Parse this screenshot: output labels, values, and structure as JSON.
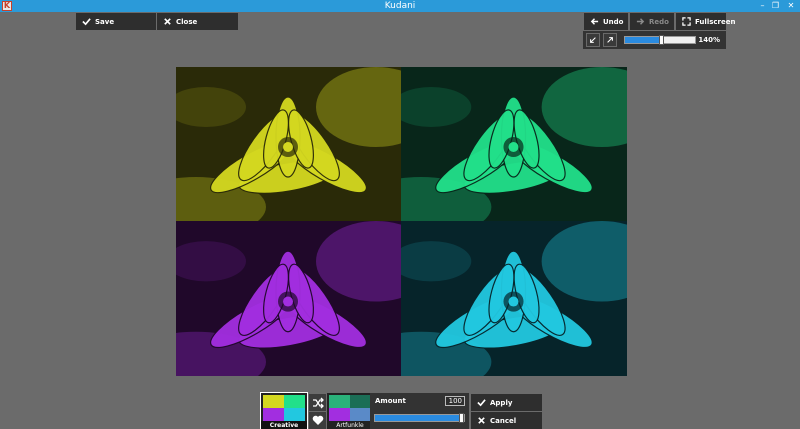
{
  "window": {
    "title": "Kudani",
    "app_icon_letter": "K",
    "minimize": "–",
    "maximize": "❐",
    "close": "✕"
  },
  "toolbar": {
    "save_label": "Save",
    "close_label": "Close",
    "undo_label": "Undo",
    "redo_label": "Redo",
    "fullscreen_label": "Fullscreen"
  },
  "zoom": {
    "value_label": "140%",
    "fraction": 0.52
  },
  "canvas": {
    "tiles": [
      {
        "name": "yellow",
        "color": "#d4d820",
        "dark": "#2a2a08"
      },
      {
        "name": "green",
        "color": "#22e08a",
        "dark": "#08261a"
      },
      {
        "name": "purple",
        "color": "#a22ee0",
        "dark": "#20082a"
      },
      {
        "name": "cyan",
        "color": "#22c8e0",
        "dark": "#06242a"
      }
    ]
  },
  "presets": [
    {
      "label": "Creative",
      "active": true,
      "colors": [
        "#d4d820",
        "#22e08a",
        "#a22ee0",
        "#22c8e0"
      ]
    },
    {
      "label": "Artfunkle",
      "active": false,
      "colors": [
        "#2ab27a",
        "#1b6e56",
        "#a22ee0",
        "#5a8ac8"
      ]
    }
  ],
  "amount": {
    "label": "Amount",
    "value": "100",
    "fraction": 1.0
  },
  "actions": {
    "apply_label": "Apply",
    "cancel_label": "Cancel"
  }
}
